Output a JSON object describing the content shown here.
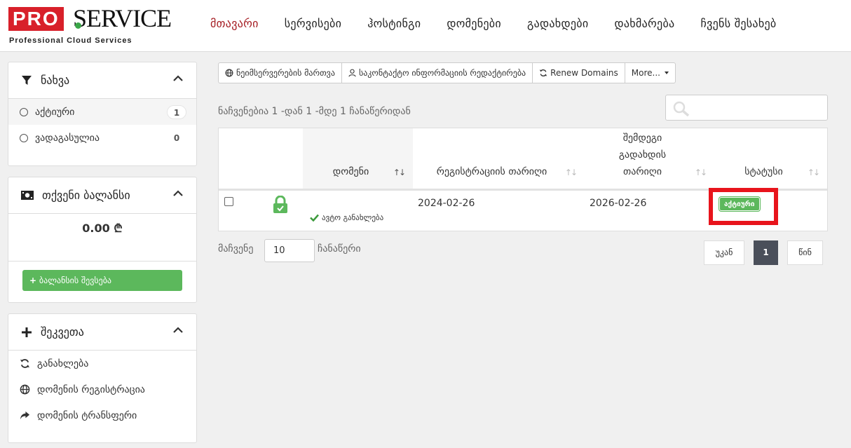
{
  "brand": {
    "logo_pro": "PRO",
    "logo_service": "SERVICE",
    "tagline": "Professional Cloud Services",
    "accent": "#a51d23",
    "logo_red": "#d8202a"
  },
  "nav": {
    "items": [
      "მთავარი",
      "სერვისები",
      "ჰოსტინგი",
      "დომენები",
      "გადახდები",
      "დახმარება",
      "ჩვენს შესახებ"
    ]
  },
  "sidebar": {
    "filter": {
      "title": "ნახვა",
      "items": [
        {
          "label": "აქტიური",
          "count": "1"
        },
        {
          "label": "ვადაგასულია",
          "count": "0"
        }
      ]
    },
    "balance": {
      "title": "თქვენი ბალანსი",
      "amount": "0.00 ₾",
      "add_button": "ბალანსის შევსება"
    },
    "actions": {
      "title": "შეკვეთა",
      "items": [
        "განახლება",
        "დომენის რეგისტრაცია",
        "დომენის ტრანსფერი"
      ]
    }
  },
  "toolbar": {
    "nameservers": "ნეიმსერვერების მართვა",
    "contacts": "საკონტაქტო ინფორმაციის რედაქტირება",
    "renew": "Renew Domains",
    "more": "More..."
  },
  "list": {
    "showing": "ნაჩვენებია 1 -დან 1 -მდე 1 ჩანაწერიდან",
    "search_placeholder": "",
    "columns": {
      "domain": "დომენი",
      "reg_date": "რეგისტრაციის თარიღი",
      "next_due_1": "შემდეგი",
      "next_due_2": "გადახდის",
      "next_due_3": "თარიღი",
      "status": "სტატუსი"
    },
    "rows": [
      {
        "auto_renew": "ავტო განახლება",
        "reg_date": "2024-02-26",
        "next_due": "2026-02-26",
        "status": "აქტიური"
      }
    ]
  },
  "footer": {
    "show_label": "მაჩვენე",
    "page_length": "10",
    "entries_label": "ჩანაწერი",
    "prev": "უკან",
    "current_page": "1",
    "next": "წინ"
  }
}
